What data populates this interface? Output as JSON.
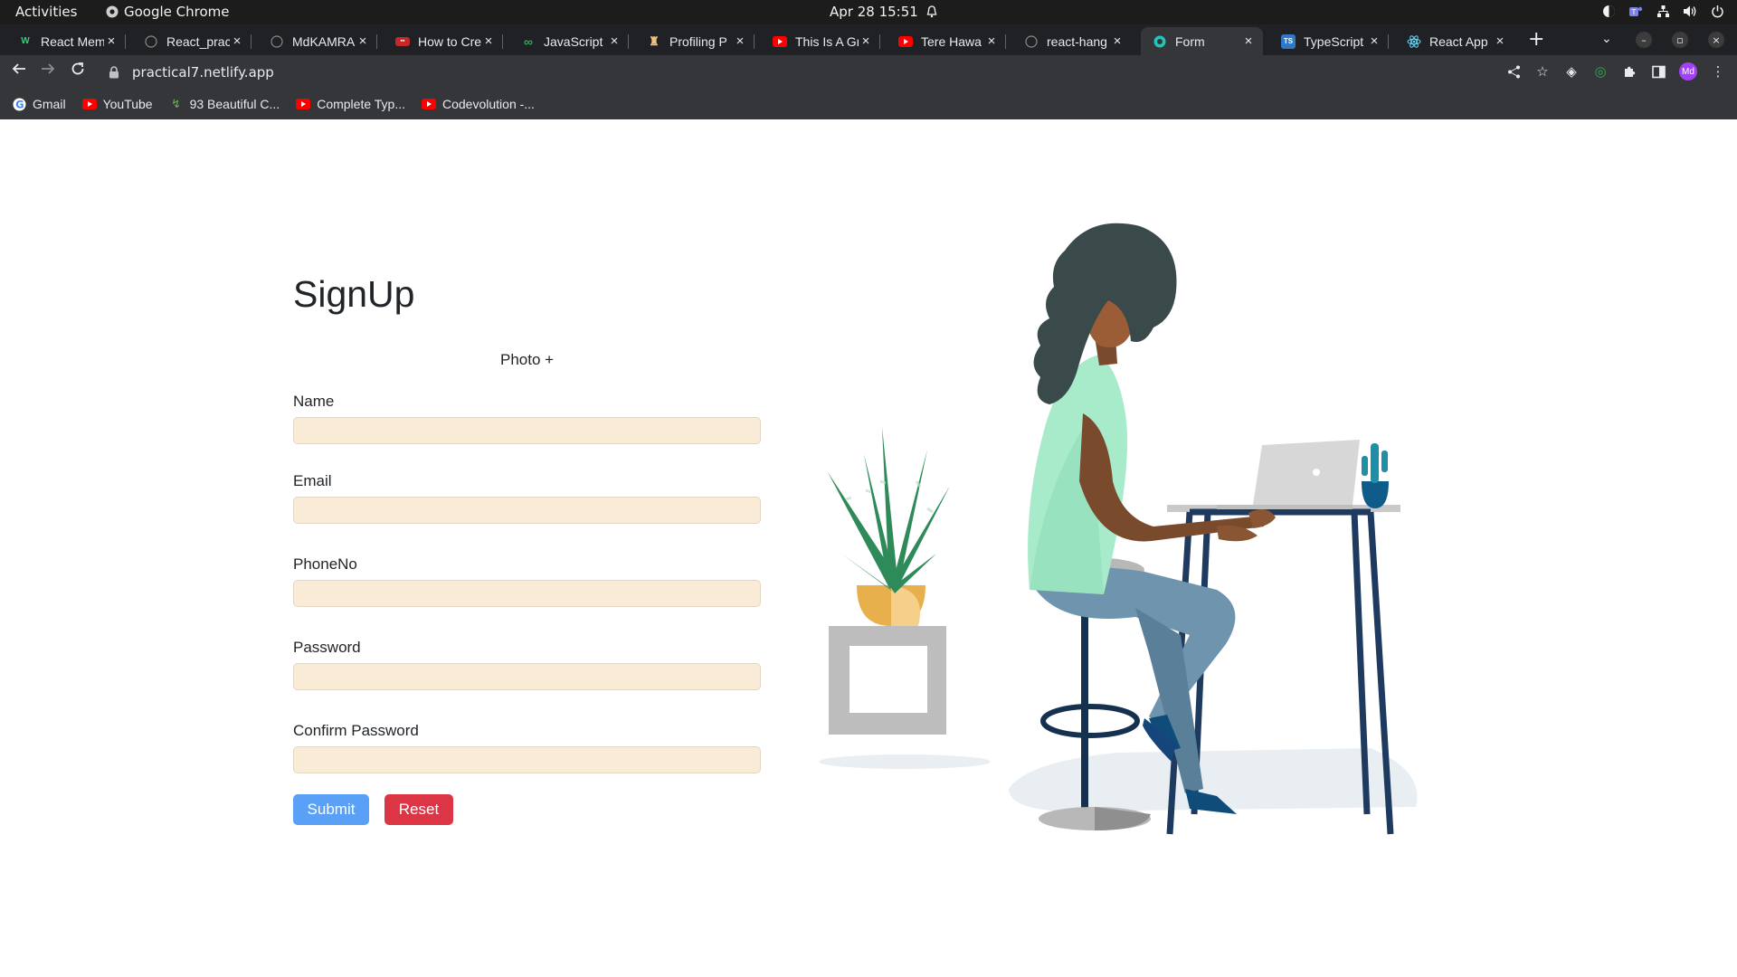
{
  "system": {
    "activities": "Activities",
    "app_name": "Google Chrome",
    "clock": "Apr 28  15:51"
  },
  "tabs": [
    {
      "title": "React Mem",
      "active": false,
      "favicon": "react-memo-favicon"
    },
    {
      "title": "React_prac",
      "active": false,
      "favicon": "github-icon"
    },
    {
      "title": "MdKAMRA",
      "active": false,
      "favicon": "github-icon"
    },
    {
      "title": "How to Cre",
      "active": false,
      "favicon": "site-favicon"
    },
    {
      "title": "JavaScript",
      "active": false,
      "favicon": "infinity-icon"
    },
    {
      "title": "Profiling P",
      "active": false,
      "favicon": "profiling-favicon"
    },
    {
      "title": "This Is A Gr",
      "active": false,
      "favicon": "youtube-icon"
    },
    {
      "title": "Tere Hawa",
      "active": false,
      "favicon": "youtube-icon"
    },
    {
      "title": "react-hang",
      "active": false,
      "favicon": "github-icon"
    },
    {
      "title": "Form",
      "active": true,
      "favicon": "netlify-icon"
    },
    {
      "title": "TypeScript",
      "active": false,
      "favicon": "typescript-icon"
    },
    {
      "title": "React App",
      "active": false,
      "favicon": "react-icon"
    }
  ],
  "toolbar": {
    "url": "practical7.netlify.app",
    "avatar": "Md"
  },
  "bookmarks": [
    {
      "label": "Gmail",
      "icon": "google-icon"
    },
    {
      "label": "YouTube",
      "icon": "youtube-icon"
    },
    {
      "label": "93 Beautiful C...",
      "icon": "css-icon"
    },
    {
      "label": "Complete Typ...",
      "icon": "youtube-icon"
    },
    {
      "label": "Codevolution -...",
      "icon": "youtube-icon"
    }
  ],
  "form": {
    "title": "SignUp",
    "photo_button": "Photo +",
    "fields": [
      {
        "label": "Name",
        "value": ""
      },
      {
        "label": "Email",
        "value": ""
      },
      {
        "label": "PhoneNo",
        "value": ""
      },
      {
        "label": "Password",
        "value": ""
      },
      {
        "label": "Confirm Password",
        "value": ""
      }
    ],
    "submit_label": "Submit",
    "reset_label": "Reset"
  },
  "colors": {
    "input_bg": "#faebd7",
    "submit": "#5aa0f7",
    "reset": "#dc3545"
  }
}
